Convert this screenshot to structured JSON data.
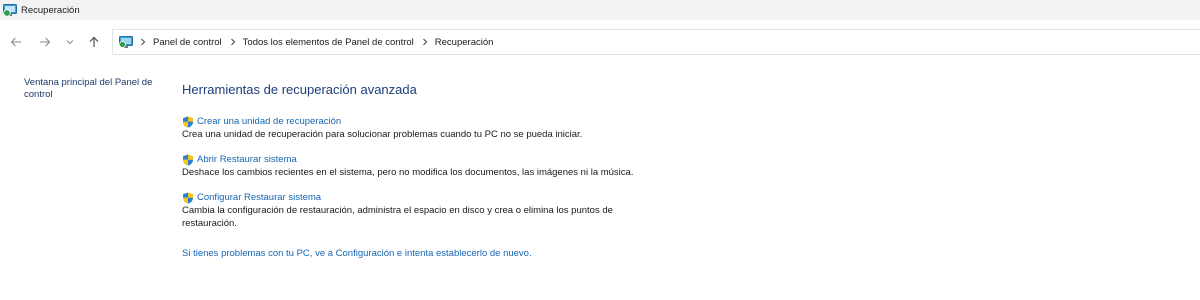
{
  "window": {
    "title": "Recuperación"
  },
  "nav": {
    "breadcrumb": [
      "Panel de control",
      "Todos los elementos de Panel de control",
      "Recuperación"
    ]
  },
  "sidebar": {
    "link": "Ventana principal del Panel de control"
  },
  "main": {
    "heading": "Herramientas de recuperación avanzada",
    "tasks": [
      {
        "link": "Crear una unidad de recuperación",
        "description": "Crea una unidad de recuperación para solucionar problemas cuando tu PC no se pueda iniciar."
      },
      {
        "link": "Abrir Restaurar sistema",
        "description": "Deshace los cambios recientes en el sistema, pero no modifica los documentos, las imágenes ni la música."
      },
      {
        "link": "Configurar Restaurar sistema",
        "description": "Cambia la configuración de restauración, administra el espacio en disco y crea o elimina los puntos de restauración."
      }
    ],
    "settings_link": "Si tienes problemas con tu PC, ve a Configuración e intenta establecerlo de nuevo."
  },
  "icons": {
    "window": "control-panel-recovery-icon",
    "back": "arrow-left-icon",
    "forward": "arrow-right-icon",
    "recent": "chevron-down-icon",
    "up": "arrow-up-icon",
    "crumb": "control-panel-icon",
    "shield": "uac-shield-icon"
  }
}
